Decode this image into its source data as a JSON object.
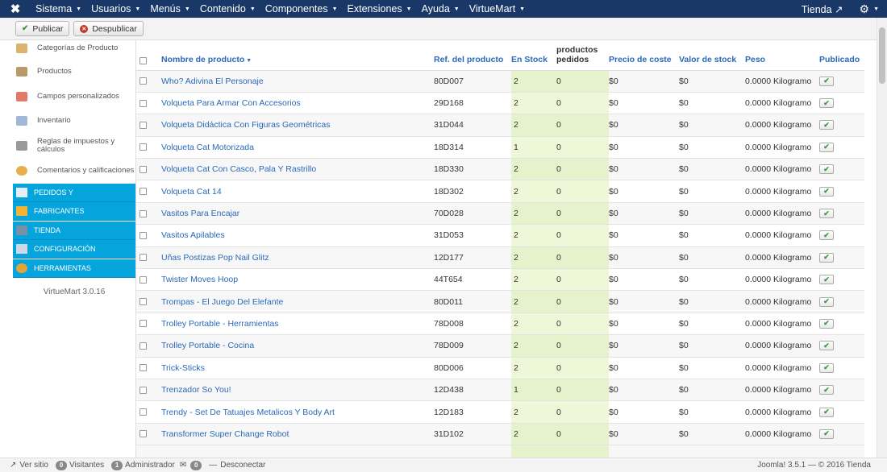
{
  "nav": {
    "logo": "✖",
    "menus": [
      {
        "label": "Sistema"
      },
      {
        "label": "Usuarios"
      },
      {
        "label": "Menús"
      },
      {
        "label": "Contenido"
      },
      {
        "label": "Componentes"
      },
      {
        "label": "Extensiones"
      },
      {
        "label": "Ayuda"
      },
      {
        "label": "VirtueMart"
      }
    ],
    "tienda": "Tienda ↗",
    "gear": "⚙"
  },
  "toolbar": {
    "publicar": "Publicar",
    "despublicar": "Despublicar"
  },
  "sidebar": {
    "items": [
      {
        "label": "Categorías de Producto",
        "icon": "folder-icon"
      },
      {
        "label": "Productos",
        "icon": "box-icon"
      },
      {
        "label": "Campos personalizados",
        "icon": "custom-fields-icon"
      },
      {
        "label": "Inventario",
        "icon": "chart-icon"
      },
      {
        "label": "Reglas de impuestos y cálculos",
        "icon": "calculator-icon"
      },
      {
        "label": "Comentarios y calificaciones",
        "icon": "comment-icon"
      }
    ],
    "sections": [
      {
        "label": "PEDIDOS Y",
        "icon": "orders-icon"
      },
      {
        "label": "FABRICANTES",
        "icon": "wrench-icon"
      },
      {
        "label": "TIENDA",
        "icon": "shop-icon"
      },
      {
        "label": "CONFIGURACIÓN",
        "icon": "config-icon"
      },
      {
        "label": "HERRAMIENTAS",
        "icon": "tools-icon"
      }
    ],
    "version": "VirtueMart 3.0.16"
  },
  "table": {
    "headers": {
      "nombre": "Nombre de producto",
      "ref": "Ref. del producto",
      "stock": "En Stock",
      "pedidos": "productos pedidos",
      "precio": "Precio de coste",
      "valor": "Valor de stock",
      "peso": "Peso",
      "publicado": "Publicado"
    },
    "rows": [
      {
        "name": "Who? Adivina El Personaje",
        "ref": "80D007",
        "stock": "2",
        "ordered": "0",
        "cost": "$0",
        "value": "$0",
        "weight": "0.0000 Kilogramo"
      },
      {
        "name": "Volqueta Para Armar Con Accesorios",
        "ref": "29D168",
        "stock": "2",
        "ordered": "0",
        "cost": "$0",
        "value": "$0",
        "weight": "0.0000 Kilogramo"
      },
      {
        "name": "Volqueta Didáctica Con Figuras Geométricas",
        "ref": "31D044",
        "stock": "2",
        "ordered": "0",
        "cost": "$0",
        "value": "$0",
        "weight": "0.0000 Kilogramo"
      },
      {
        "name": "Volqueta Cat Motorizada",
        "ref": "18D314",
        "stock": "1",
        "ordered": "0",
        "cost": "$0",
        "value": "$0",
        "weight": "0.0000 Kilogramo"
      },
      {
        "name": "Volqueta Cat Con Casco, Pala Y Rastrillo",
        "ref": "18D330",
        "stock": "2",
        "ordered": "0",
        "cost": "$0",
        "value": "$0",
        "weight": "0.0000 Kilogramo"
      },
      {
        "name": "Volqueta Cat 14",
        "ref": "18D302",
        "stock": "2",
        "ordered": "0",
        "cost": "$0",
        "value": "$0",
        "weight": "0.0000 Kilogramo"
      },
      {
        "name": "Vasitos Para Encajar",
        "ref": "70D028",
        "stock": "2",
        "ordered": "0",
        "cost": "$0",
        "value": "$0",
        "weight": "0.0000 Kilogramo"
      },
      {
        "name": "Vasitos Apilables",
        "ref": "31D053",
        "stock": "2",
        "ordered": "0",
        "cost": "$0",
        "value": "$0",
        "weight": "0.0000 Kilogramo"
      },
      {
        "name": "Uñas Postizas Pop Nail Glitz",
        "ref": "12D177",
        "stock": "2",
        "ordered": "0",
        "cost": "$0",
        "value": "$0",
        "weight": "0.0000 Kilogramo"
      },
      {
        "name": "Twister Moves Hoop",
        "ref": "44T654",
        "stock": "2",
        "ordered": "0",
        "cost": "$0",
        "value": "$0",
        "weight": "0.0000 Kilogramo"
      },
      {
        "name": "Trompas - El Juego Del Elefante",
        "ref": "80D011",
        "stock": "2",
        "ordered": "0",
        "cost": "$0",
        "value": "$0",
        "weight": "0.0000 Kilogramo"
      },
      {
        "name": "Trolley Portable - Herramientas",
        "ref": "78D008",
        "stock": "2",
        "ordered": "0",
        "cost": "$0",
        "value": "$0",
        "weight": "0.0000 Kilogramo"
      },
      {
        "name": "Trolley Portable - Cocina",
        "ref": "78D009",
        "stock": "2",
        "ordered": "0",
        "cost": "$0",
        "value": "$0",
        "weight": "0.0000 Kilogramo"
      },
      {
        "name": "Trick-Sticks",
        "ref": "80D006",
        "stock": "2",
        "ordered": "0",
        "cost": "$0",
        "value": "$0",
        "weight": "0.0000 Kilogramo"
      },
      {
        "name": "Trenzador So You!",
        "ref": "12D438",
        "stock": "1",
        "ordered": "0",
        "cost": "$0",
        "value": "$0",
        "weight": "0.0000 Kilogramo"
      },
      {
        "name": "Trendy - Set De Tatuajes Metalicos Y Body Art",
        "ref": "12D183",
        "stock": "2",
        "ordered": "0",
        "cost": "$0",
        "value": "$0",
        "weight": "0.0000 Kilogramo"
      },
      {
        "name": "Transformer Super Change Robot",
        "ref": "31D102",
        "stock": "2",
        "ordered": "0",
        "cost": "$0",
        "value": "$0",
        "weight": "0.0000 Kilogramo"
      }
    ]
  },
  "status": {
    "ver_sitio": "Ver sitio",
    "visitantes_count": "0",
    "visitantes": "Visitantes",
    "admin_count": "1",
    "admin": "Administrador",
    "msg_count": "0",
    "desconectar": "Desconectar",
    "footer": "Joomla! 3.5.1 — © 2016 Tienda"
  }
}
